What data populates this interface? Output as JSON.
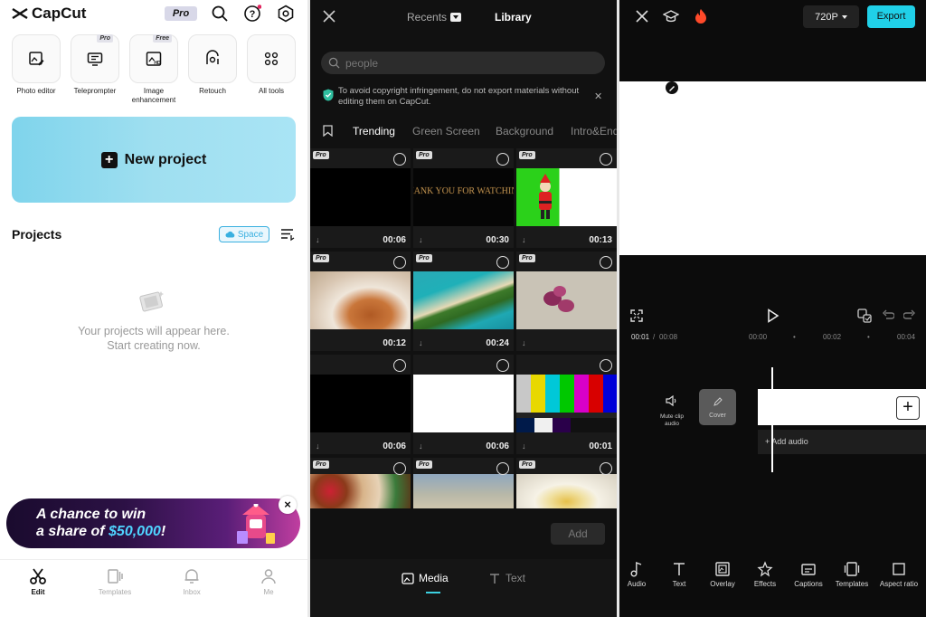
{
  "home": {
    "brand": "CapCut",
    "pro_badge": "Pro",
    "tools": [
      {
        "label": "Photo editor",
        "tag": ""
      },
      {
        "label": "Teleprompter",
        "tag": "Pro"
      },
      {
        "label": "Image enhancement",
        "tag": "Free"
      },
      {
        "label": "Retouch",
        "tag": ""
      },
      {
        "label": "All tools",
        "tag": ""
      }
    ],
    "new_project": "New project",
    "projects_title": "Projects",
    "space_button": "Space",
    "empty_line1": "Your projects will appear here.",
    "empty_line2": "Start creating now.",
    "promo_line1": "A chance to win",
    "promo_line2_prefix": "a share of ",
    "promo_amount": "$50,000",
    "promo_line2_suffix": "!",
    "nav": [
      {
        "label": "Edit",
        "icon": "scissors-icon"
      },
      {
        "label": "Templates",
        "icon": "templates-icon"
      },
      {
        "label": "Inbox",
        "icon": "bell-icon"
      },
      {
        "label": "Me",
        "icon": "person-icon"
      }
    ]
  },
  "library": {
    "tab_recents": "Recents",
    "tab_library": "Library",
    "search_placeholder": "people",
    "notice": "To avoid copyright infringement, do not export materials without editing them on CapCut.",
    "categories": [
      "Trending",
      "Green Screen",
      "Background",
      "Intro&End"
    ],
    "thank_you_text": "THANK YOU FOR WATCHING",
    "items": [
      {
        "pro": true,
        "duration": "00:06"
      },
      {
        "pro": true,
        "duration": "00:30"
      },
      {
        "pro": true,
        "duration": "00:13"
      },
      {
        "pro": true,
        "duration": "00:12"
      },
      {
        "pro": true,
        "duration": "00:24"
      },
      {
        "pro": true,
        "duration": ""
      },
      {
        "pro": false,
        "duration": "00:06"
      },
      {
        "pro": false,
        "duration": "00:06"
      },
      {
        "pro": false,
        "duration": "00:01"
      },
      {
        "pro": true,
        "duration": ""
      },
      {
        "pro": true,
        "duration": ""
      },
      {
        "pro": true,
        "duration": ""
      }
    ],
    "add_button": "Add",
    "bottom_media": "Media",
    "bottom_text": "Text"
  },
  "editor": {
    "resolution": "720P",
    "export": "Export",
    "current_time": "00:01",
    "total_time": "00:08",
    "ruler": [
      "00:00",
      "00:02",
      "00:04"
    ],
    "mute_label": "Mute clip audio",
    "cover_label": "Cover",
    "add_audio": "Add audio",
    "toolbar": [
      "Audio",
      "Text",
      "Overlay",
      "Effects",
      "Captions",
      "Templates",
      "Aspect ratio"
    ]
  },
  "colors": {
    "accent_cyan": "#20d0e8",
    "space_blue": "#3ab0e0",
    "promo_amount": "#4fd4ff"
  }
}
